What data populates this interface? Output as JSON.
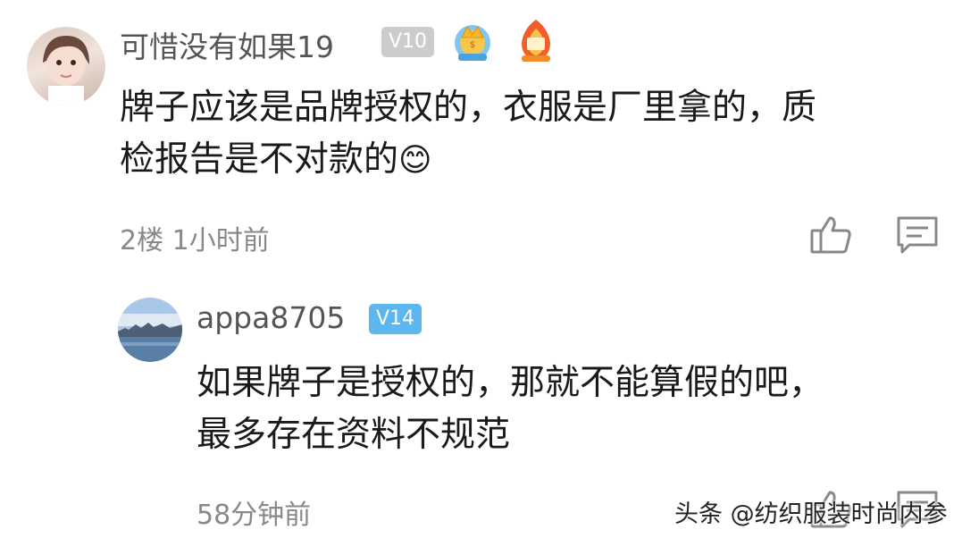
{
  "comments": [
    {
      "username": "可惜没有如果19",
      "level": "V10",
      "level_color": "#cccccc",
      "badges": [
        "crown-medal-icon",
        "fire-medal-icon"
      ],
      "text_line1": "牌子应该是品牌授权的，衣服是厂里拿的，质",
      "text_line2": "检报告是不对款的",
      "emoji": "😊",
      "floor": "2楼",
      "time": "1小时前",
      "actions": [
        "like-icon",
        "reply-icon"
      ]
    },
    {
      "username": "appa8705",
      "level": "V14",
      "level_color": "#5cb6ef",
      "text_line1": "如果牌子是授权的，那就不能算假的吧，",
      "text_line2": "最多存在资料不规范",
      "time": "58分钟前",
      "actions": [
        "like-icon",
        "reply-icon"
      ]
    }
  ],
  "watermark": "头条 @纺织服装时尚内参"
}
